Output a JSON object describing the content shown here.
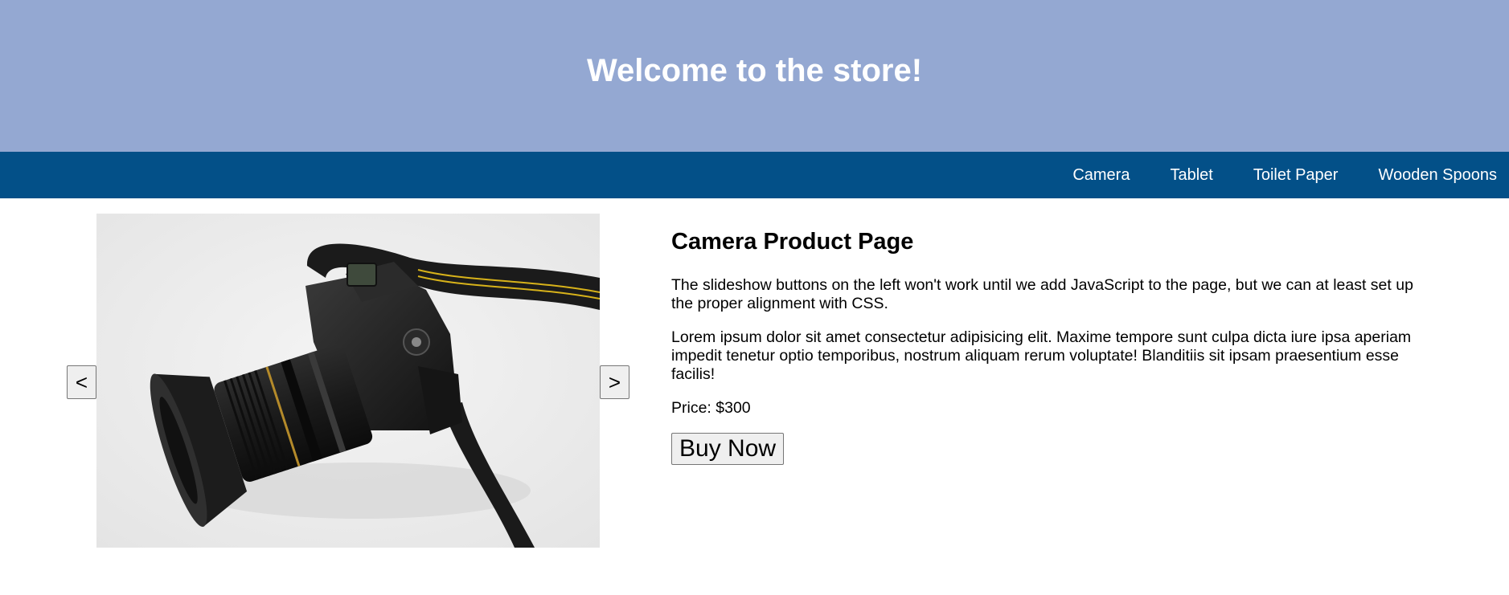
{
  "header": {
    "title": "Welcome to the store!"
  },
  "nav": {
    "items": [
      {
        "label": "Camera"
      },
      {
        "label": "Tablet"
      },
      {
        "label": "Toilet Paper"
      },
      {
        "label": "Wooden Spoons"
      }
    ]
  },
  "slideshow": {
    "prev_label": "<",
    "next_label": ">",
    "image": "dslr-camera-photo"
  },
  "product": {
    "title": "Camera Product Page",
    "paragraphs": [
      "The slideshow buttons on the left won't work until we add JavaScript to the page, but we can at least set up the proper alignment with CSS.",
      "Lorem ipsum dolor sit amet consectetur adipisicing elit. Maxime tempore sunt culpa dicta iure ipsa aperiam impedit tenetur optio temporibus, nostrum aliquam rerum voluptate! Blanditiis sit ipsam praesentium esse facilis!"
    ],
    "price": "Price: $300",
    "buy_label": "Buy Now"
  },
  "colors": {
    "header_bg": "#94a8d2",
    "nav_bg": "#035088",
    "nav_text": "#ffffff"
  }
}
